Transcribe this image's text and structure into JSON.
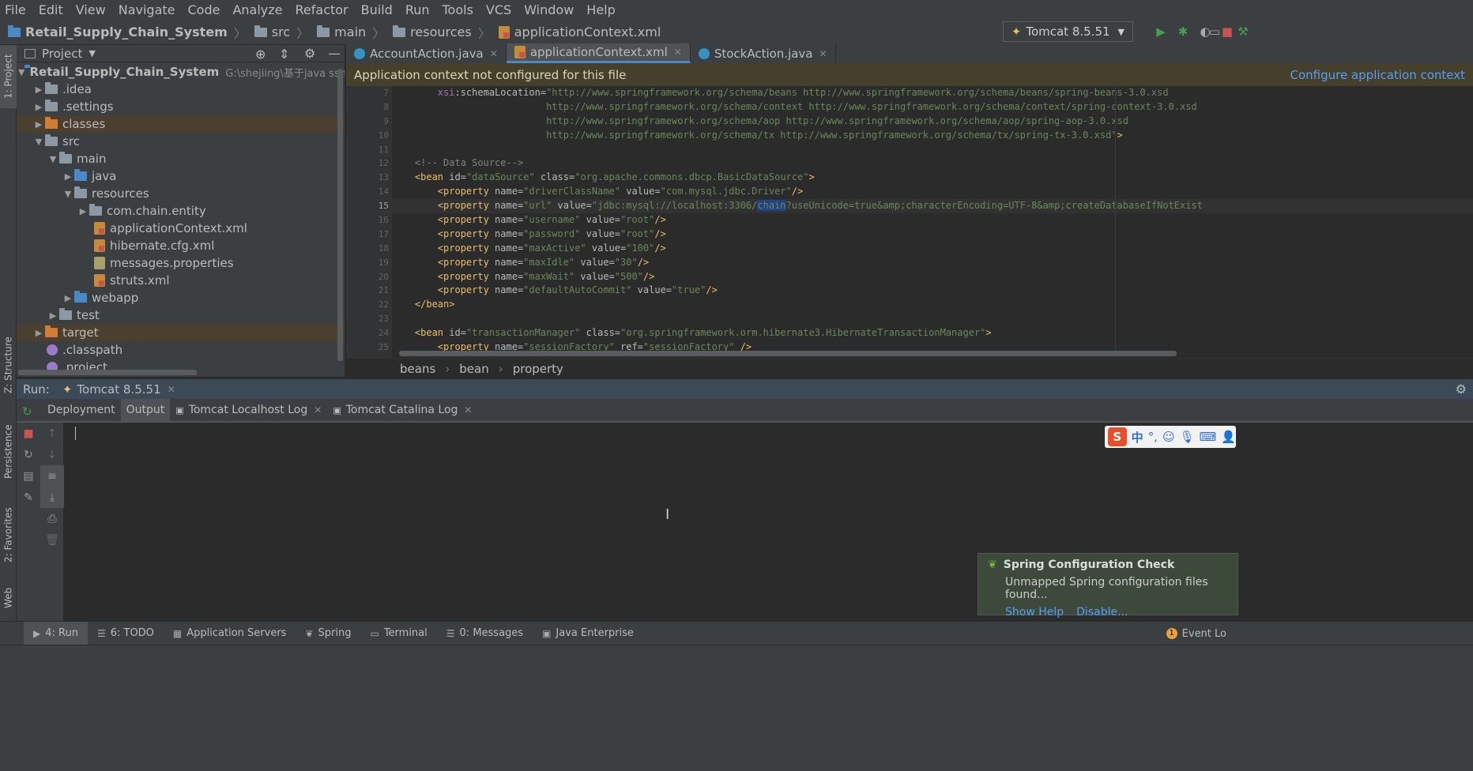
{
  "menu": [
    "File",
    "Edit",
    "View",
    "Navigate",
    "Code",
    "Analyze",
    "Refactor",
    "Build",
    "Run",
    "Tools",
    "VCS",
    "Window",
    "Help"
  ],
  "breadcrumb": [
    "Retail_Supply_Chain_System",
    "src",
    "main",
    "resources",
    "applicationContext.xml"
  ],
  "run_config": "Tomcat 8.5.51",
  "project_panel": {
    "title": "Project",
    "root_name": "Retail_Supply_Chain_System",
    "root_path": "G:\\shejiing\\基于java ssh的零售百货",
    "items": [
      ".idea",
      ".settings",
      "classes",
      "src",
      "main",
      "java",
      "resources",
      "com.chain.entity",
      "applicationContext.xml",
      "hibernate.cfg.xml",
      "messages.properties",
      "struts.xml",
      "webapp",
      "test",
      "target",
      ".classpath",
      ".project"
    ]
  },
  "editor_tabs": [
    "AccountAction.java",
    "applicationContext.xml",
    "StockAction.java"
  ],
  "banner": {
    "message": "Application context not configured for this file",
    "action": "Configure application context"
  },
  "line_numbers": [
    "7",
    "8",
    "9",
    "10",
    "11",
    "12",
    "13",
    "14",
    "15",
    "16",
    "17",
    "18",
    "19",
    "20",
    "21",
    "22",
    "23",
    "24",
    "25"
  ],
  "editor_breadcrumb": [
    "beans",
    "bean",
    "property"
  ],
  "run_panel": {
    "label": "Run:",
    "config_tab": "Tomcat 8.5.51",
    "tabs": [
      "Deployment",
      "Output",
      "Tomcat Localhost Log",
      "Tomcat Catalina Log"
    ]
  },
  "notification": {
    "title": "Spring Configuration Check",
    "body": "Unmapped Spring configuration files found...",
    "link1": "Show Help",
    "link2": "Disable..."
  },
  "bottom_tabs": [
    "4: Run",
    "6: TODO",
    "Application Servers",
    "Spring",
    "Terminal",
    "0: Messages",
    "Java Enterprise"
  ],
  "event_log": "Event Lo",
  "left_strip": [
    "1: Project",
    "Z: Structure",
    "Persistence",
    "2: Favorites",
    "Web"
  ],
  "ime_label": "中",
  "colors": {
    "accent": "#4a88c7",
    "run_green": "#499c54",
    "stop_red": "#c75450",
    "banner_bg": "#45402c"
  }
}
